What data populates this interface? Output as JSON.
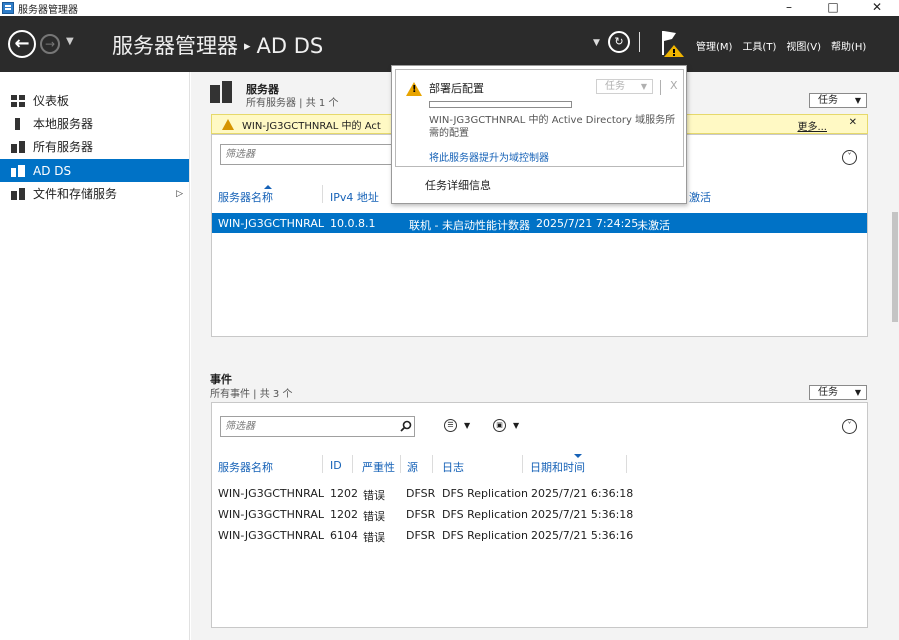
{
  "window": {
    "title": "服务器管理器",
    "controls": [
      "–",
      "□",
      "✕"
    ]
  },
  "header": {
    "app_name": "服务器管理器",
    "separator": "▸",
    "page": "AD DS",
    "menu": [
      "管理(M)",
      "工具(T)",
      "视图(V)",
      "帮助(H)"
    ]
  },
  "sidebar": {
    "items": [
      {
        "label": "仪表板",
        "icon": "dashboard-icon"
      },
      {
        "label": "本地服务器",
        "icon": "local-server-icon"
      },
      {
        "label": "所有服务器",
        "icon": "all-servers-icon"
      },
      {
        "label": "AD DS",
        "icon": "adds-icon",
        "active": true
      },
      {
        "label": "文件和存储服务",
        "icon": "file-storage-icon",
        "has_submenu": true
      }
    ],
    "submenu_arrow": "▷"
  },
  "servers": {
    "title": "服务器",
    "subtitle": "所有服务器 | 共 1 个",
    "tasks_label": "任务",
    "alert": {
      "text": "WIN-JG3GCTHNRAL 中的 Act",
      "more": "更多...",
      "close": "✕"
    },
    "filter_placeholder": "筛选器",
    "columns": [
      "服务器名称",
      "IPv4 地址",
      "激活"
    ],
    "rows": [
      {
        "name": "WIN-JG3GCTHNRAL",
        "ip": "10.0.8.1",
        "status": "联机 - 未启动性能计数器",
        "date": "2025/7/21 7:24:25",
        "activation": "未激活"
      }
    ]
  },
  "events": {
    "title": "事件",
    "subtitle": "所有事件 | 共 3 个",
    "tasks_label": "任务",
    "filter_placeholder": "筛选器",
    "columns": [
      "服务器名称",
      "ID",
      "严重性",
      "源",
      "日志",
      "日期和时间"
    ],
    "rows": [
      {
        "server": "WIN-JG3GCTHNRAL",
        "id": "1202",
        "severity": "错误",
        "source": "DFSR",
        "log": "DFS Replication",
        "datetime": "2025/7/21 6:36:18"
      },
      {
        "server": "WIN-JG3GCTHNRAL",
        "id": "1202",
        "severity": "错误",
        "source": "DFSR",
        "log": "DFS Replication",
        "datetime": "2025/7/21 5:36:18"
      },
      {
        "server": "WIN-JG3GCTHNRAL",
        "id": "6104",
        "severity": "错误",
        "source": "DFSR",
        "log": "DFS Replication",
        "datetime": "2025/7/21 5:36:16"
      }
    ]
  },
  "notification": {
    "title": "部署后配置",
    "tasks_label": "任务",
    "close": "X",
    "progress": 0,
    "message": "WIN-JG3GCTHNRAL 中的 Active Directory 域服务所需的配置",
    "link": "将此服务器提升为域控制器",
    "details": "任务详细信息"
  },
  "colors": {
    "header_bg": "#2b2b2b",
    "accent": "#0072c6",
    "link": "#1662b7",
    "alert_bg": "#fff9c4",
    "warning": "#e8a400"
  }
}
